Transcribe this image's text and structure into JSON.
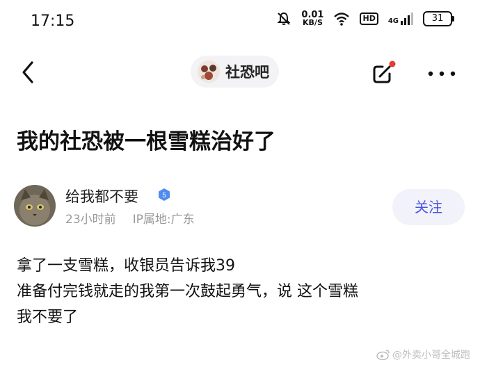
{
  "status_bar": {
    "time": "17:15",
    "net_speed_value": "0.01",
    "net_speed_unit": "KB/S",
    "hd_label": "HD",
    "network_type": "4G",
    "battery": "31"
  },
  "nav": {
    "forum_name": "社恐吧"
  },
  "post": {
    "title": "我的社恐被一根雪糕治好了",
    "author": {
      "name": "给我都不要",
      "level": "5",
      "time": "23小时前",
      "ip_location": "IP属地:广东"
    },
    "follow_label": "关注",
    "content_lines": [
      "拿了一支雪糕，收银员告诉我39",
      "准备付完钱就走的我第一次鼓起勇气，说 这个雪糕",
      "我不要了"
    ]
  },
  "watermark": "@外卖小哥全城跑",
  "colors": {
    "accent": "#4b53e0",
    "notification_dot": "#e53935",
    "meta_text": "#9a9a9a"
  }
}
